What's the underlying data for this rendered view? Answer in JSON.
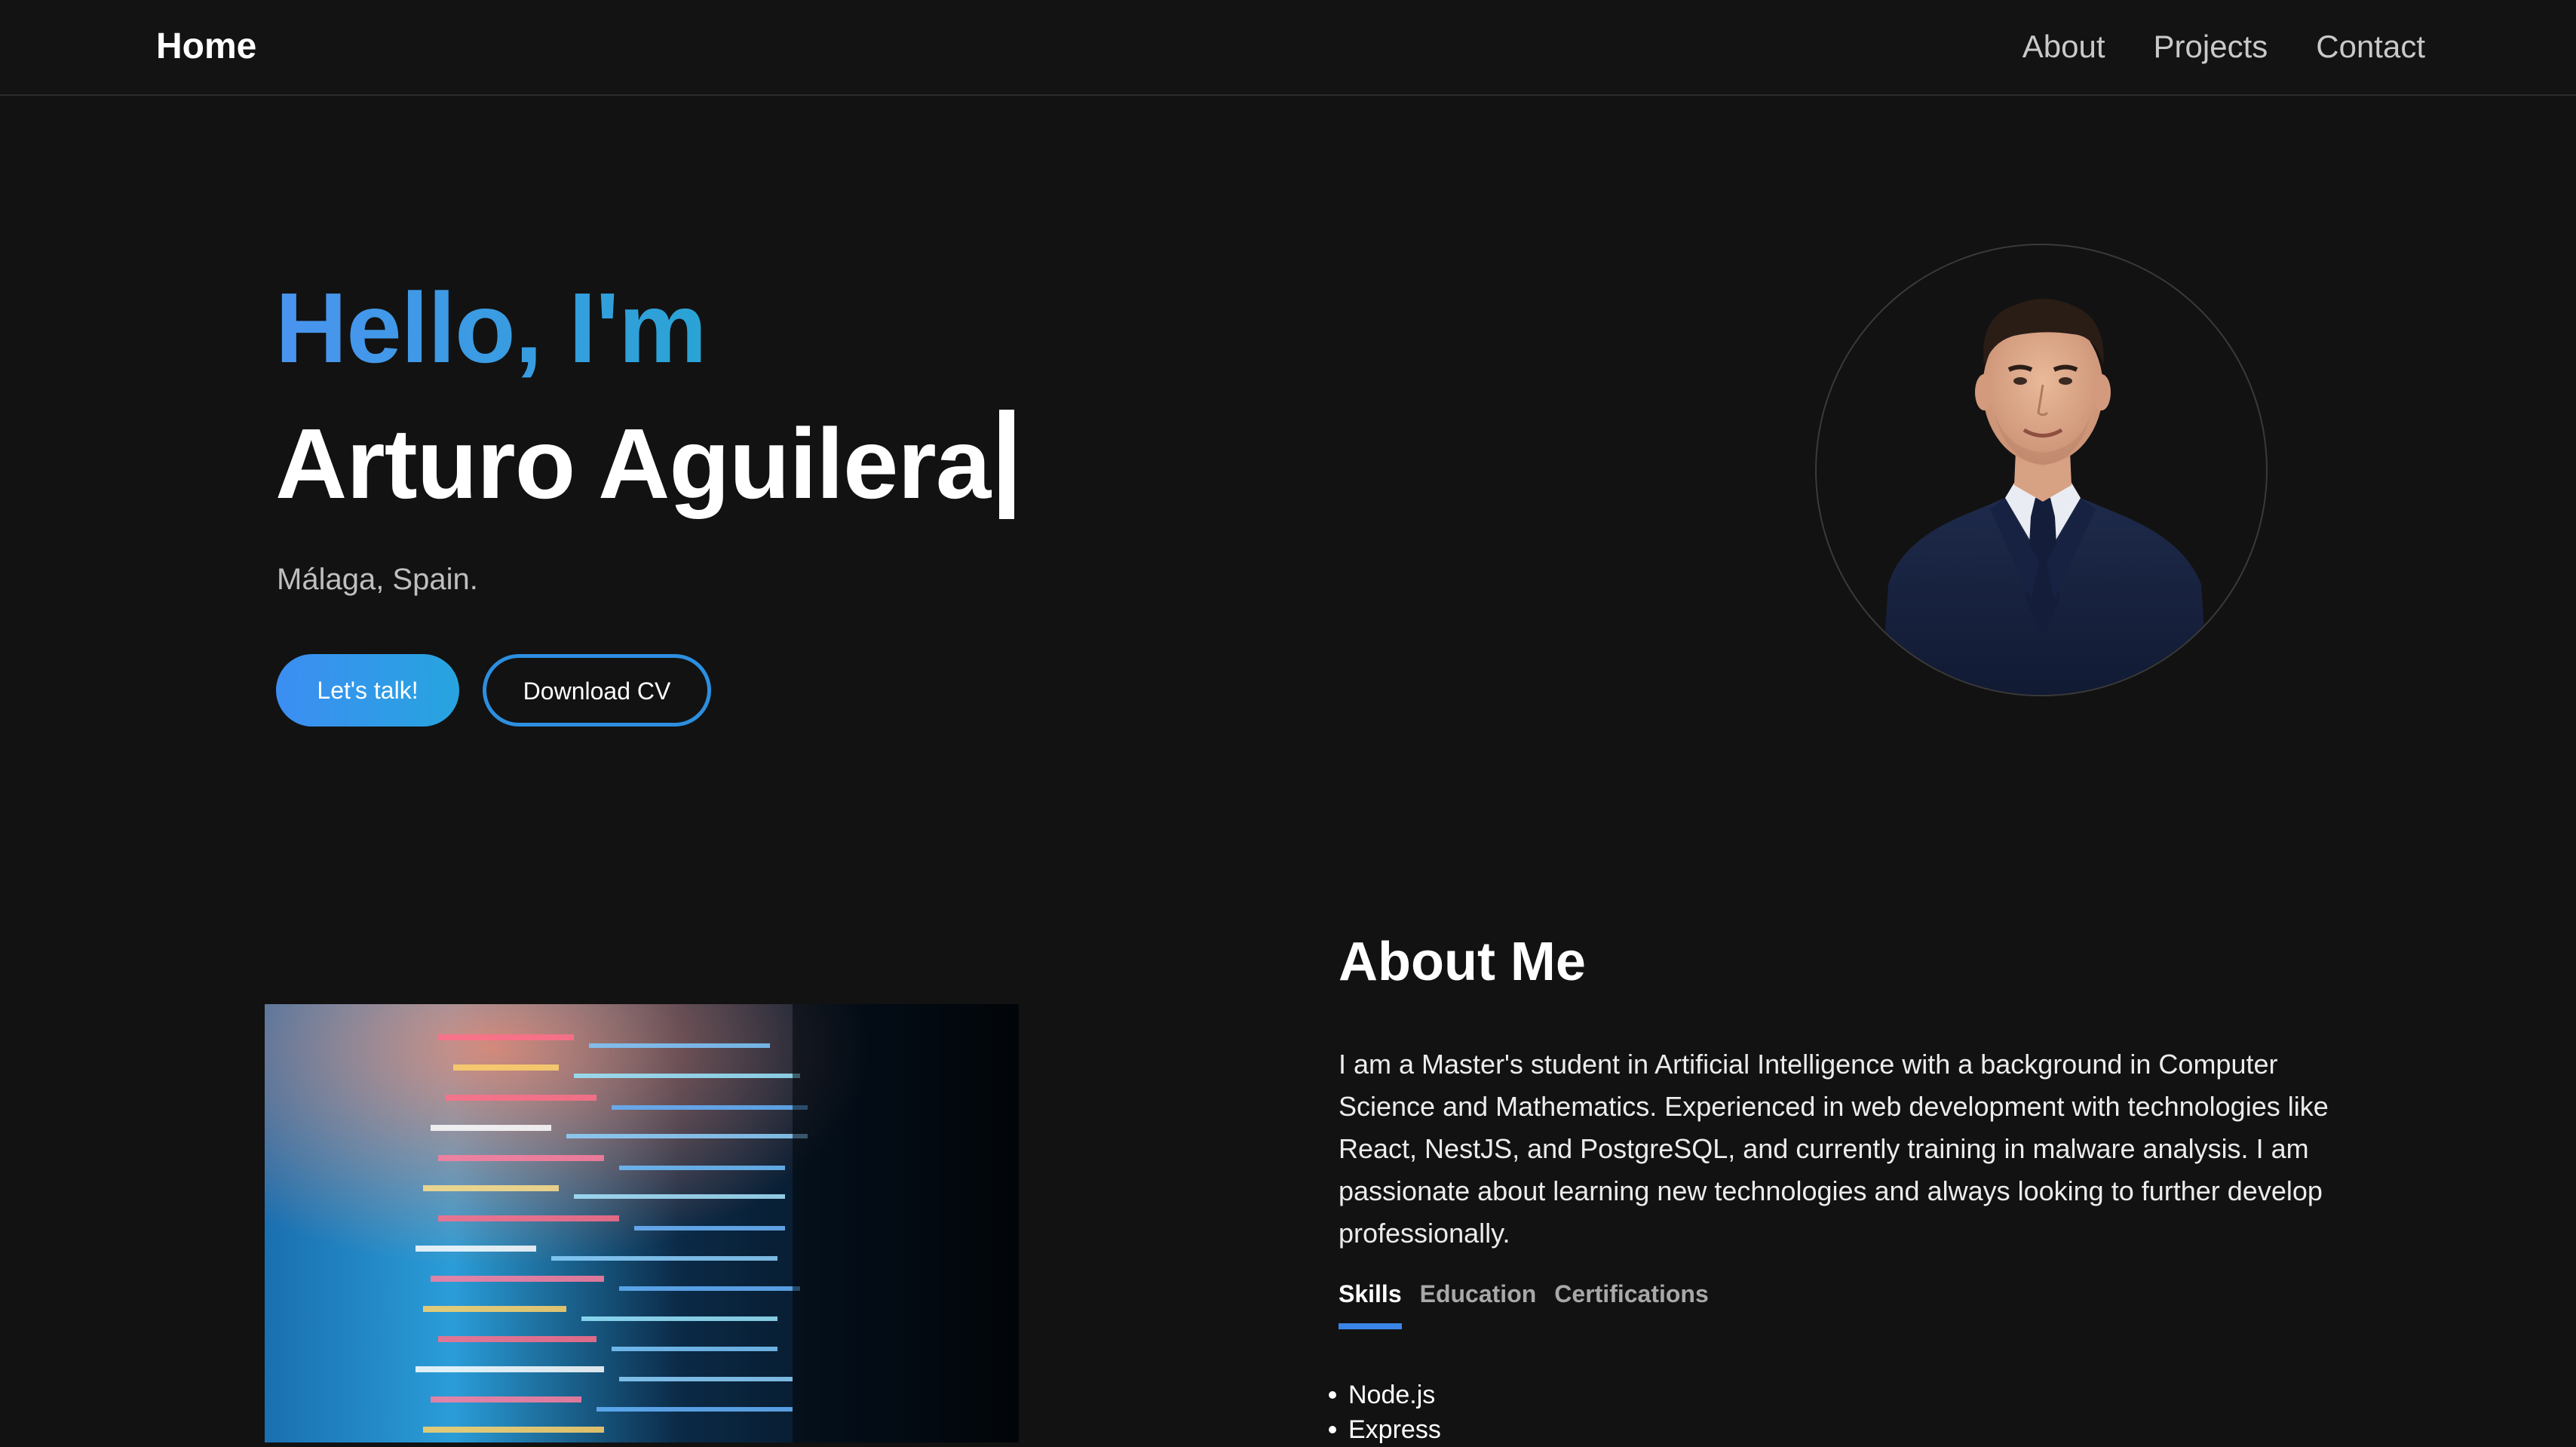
{
  "nav": {
    "home": "Home",
    "links": [
      "About",
      "Projects",
      "Contact"
    ]
  },
  "hero": {
    "greeting": "Hello, I'm",
    "name": "Arturo Aguilera",
    "location": "Málaga, Spain.",
    "talk_button": "Let's talk!",
    "cv_button": "Download CV",
    "avatar_icon": "avatar-photo-icon"
  },
  "about": {
    "title": "About Me",
    "text": "I am a Master's student in Artificial Intelligence with a background in Computer Science and Mathematics. Experienced in web development with technologies like React, NestJS, and PostgreSQL, and currently training in malware analysis. I am passionate about learning new technologies and always looking to further develop professionally.",
    "image_icon": "code-screen-image",
    "tabs": [
      "Skills",
      "Education",
      "Certifications"
    ],
    "active_tab": "Skills",
    "skills": [
      "Node.js",
      "Express"
    ]
  },
  "colors": {
    "background": "#121212",
    "accent_blue": "#3a86e8",
    "accent_cyan": "#27a4df",
    "text_muted": "#c9c9c9"
  }
}
